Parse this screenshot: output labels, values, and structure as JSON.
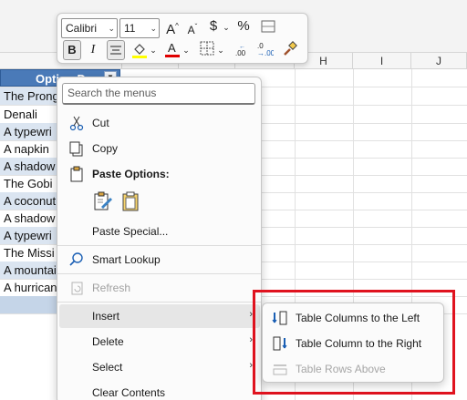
{
  "columns": [
    "H",
    "I",
    "J"
  ],
  "table": {
    "header": "Option D",
    "rows": [
      "The Prong",
      "Denali",
      "A typewri",
      "A napkin",
      "A shadow",
      "The Gobi",
      "A coconut",
      "A shadow",
      "A typewri",
      "The Missi",
      "A mountai",
      "A hurrican",
      ""
    ]
  },
  "mini_toolbar": {
    "font": "Calibri",
    "size": "11",
    "grow_font": "A",
    "shrink_font": "A",
    "currency": "$",
    "percent": "%",
    "bold": "B",
    "italic": "I",
    "fill_color": "#ffff00",
    "font_color": "#e00000"
  },
  "context_menu": {
    "search_placeholder": "Search the menus",
    "cut": "Cut",
    "copy": "Copy",
    "paste_options": "Paste Options:",
    "paste_special": "Paste Special...",
    "smart_lookup": "Smart Lookup",
    "refresh": "Refresh",
    "insert": "Insert",
    "delete": "Delete",
    "select": "Select",
    "clear_contents": "Clear Contents"
  },
  "submenu": {
    "cols_left": "Table Columns to the Left",
    "col_right": "Table Column to the Right",
    "rows_above": "Table Rows Above"
  },
  "colors": {
    "highlight": "#e0131f",
    "table_header": "#4a7ab8",
    "band": "#dbe5f1"
  }
}
